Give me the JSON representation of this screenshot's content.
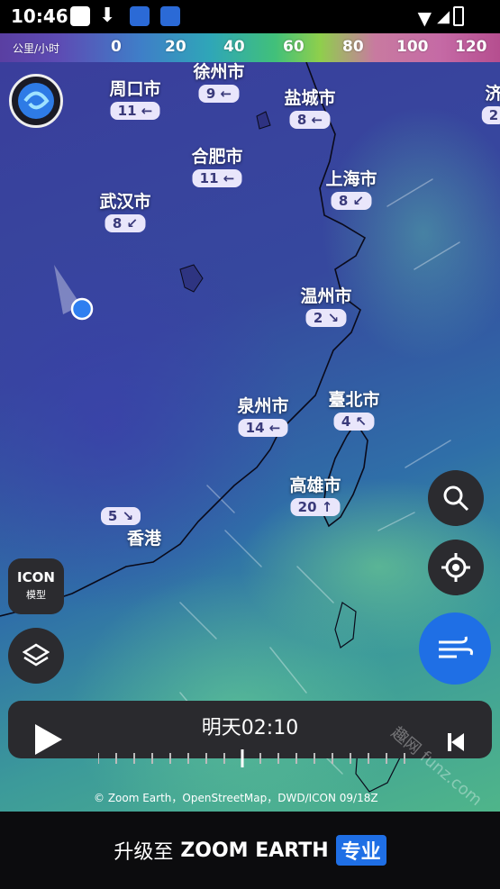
{
  "status": {
    "time": "10:46"
  },
  "legend": {
    "unit": "公里/小时",
    "values": [
      "0",
      "20",
      "40",
      "60",
      "80",
      "100",
      "120"
    ]
  },
  "cities": [
    {
      "name": "周口市",
      "speed": "11",
      "arrow": "←"
    },
    {
      "name": "徐州市",
      "speed": "9",
      "arrow": "←"
    },
    {
      "name": "盐城市",
      "speed": "8",
      "arrow": "←"
    },
    {
      "name": "济",
      "speed": "2",
      "arrow": ""
    },
    {
      "name": "合肥市",
      "speed": "11",
      "arrow": "←"
    },
    {
      "name": "上海市",
      "speed": "8",
      "arrow": "↙"
    },
    {
      "name": "武汉市",
      "speed": "8",
      "arrow": "↙"
    },
    {
      "name": "温州市",
      "speed": "2",
      "arrow": "↘"
    },
    {
      "name": "泉州市",
      "speed": "14",
      "arrow": "←"
    },
    {
      "name": "臺北市",
      "speed": "4",
      "arrow": "↖"
    },
    {
      "name": "高雄市",
      "speed": "20",
      "arrow": "↑"
    },
    {
      "name": "香港",
      "speed": "5",
      "arrow": "↘"
    }
  ],
  "model": {
    "name": "ICON",
    "label": "模型"
  },
  "player": {
    "time": "明天02:10"
  },
  "credit": "© Zoom Earth，OpenStreetMap，DWD/ICON 09/18Z",
  "promo": {
    "prefix": "升级至",
    "brand": "ZOOM EARTH",
    "badge": "专业"
  },
  "watermark": "趣网 funz.com",
  "colors": {
    "accent": "#1f6fe5",
    "location": "#2f7ff0"
  }
}
